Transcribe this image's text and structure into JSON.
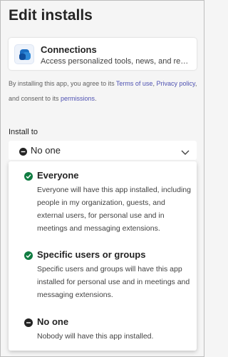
{
  "panel": {
    "title": "Edit installs"
  },
  "app": {
    "name": "Connections",
    "description": "Access personalized tools, news, and resour...",
    "icon": "connections-app-icon"
  },
  "consent": {
    "prefix": "By installing this app, you agree to its ",
    "terms_link": "Terms of use",
    "sep": ", ",
    "privacy_link": "Privacy policy",
    "middle": ", and consent to its ",
    "permissions_link": "permissions",
    "suffix": "."
  },
  "install_to": {
    "label": "Install to",
    "selected": "No one",
    "options": [
      {
        "title": "Everyone",
        "description": "Everyone will have this app installed, including people in my organization, guests, and external users, for personal use and in meetings and messaging extensions.",
        "icon": "check-circle-icon"
      },
      {
        "title": "Specific users or groups",
        "description": "Specific users and groups will have this app installed for personal use and in meetings and messaging extensions.",
        "icon": "check-circle-icon"
      },
      {
        "title": "No one",
        "description": "Nobody will have this app installed.",
        "icon": "minus-circle-icon"
      }
    ]
  },
  "colors": {
    "check": "#107c41",
    "minus": "#242424",
    "link": "#4f52b2"
  }
}
